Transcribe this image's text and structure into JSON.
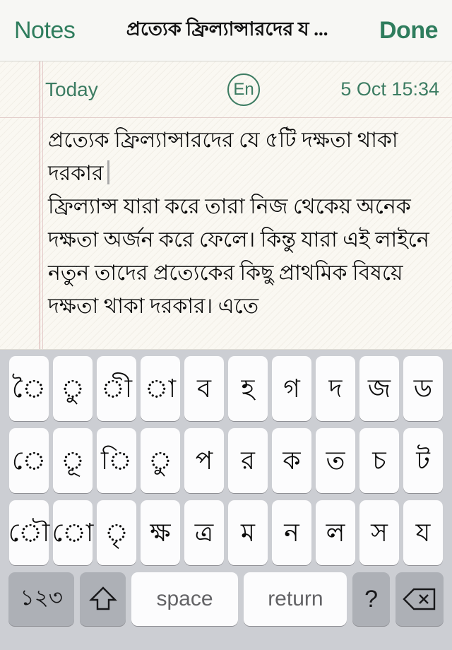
{
  "navbar": {
    "back_label": "Notes",
    "title": "প্রত্যেক ফ্রিল্যান্সারদের য ...",
    "done_label": "Done",
    "accent_color": "#2f7d5d"
  },
  "note": {
    "day_label": "Today",
    "language_badge": "En",
    "timestamp": "5 Oct 15:34",
    "body_text": "প্রত্যেক ফ্রিল্যান্সারদের যে ৫টি দক্ষতা থাকা দরকার",
    "body_rest": "\nফ্রিল্যান্স যারা করে তারা নিজ থেকেয় অনেক দক্ষতা অর্জন করে ফেলে। কিন্তু যারা এই লাইনে নতুন তাদের প্রত্যেকের কিছু প্রাথমিক বিষয়ে দক্ষতা থাকা দরকার। এতে",
    "paper_color": "#faf8f2",
    "margin_rule_color": "#c98f92",
    "meta_color": "#3c7c62"
  },
  "keyboard": {
    "background_color": "#ccced3",
    "key_color": "#fcfcfd",
    "fn_key_color": "#adb0b6",
    "rows": [
      {
        "name": "row-1",
        "keys": [
          {
            "label": "ৈ",
            "name": "key-vowel-oi"
          },
          {
            "label": "ু",
            "name": "key-vowel-u"
          },
          {
            "label": "ী",
            "name": "key-vowel-ii"
          },
          {
            "label": "া",
            "name": "key-vowel-aa"
          },
          {
            "label": "ব",
            "name": "key-ba"
          },
          {
            "label": "হ",
            "name": "key-ha"
          },
          {
            "label": "গ",
            "name": "key-ga"
          },
          {
            "label": "দ",
            "name": "key-da"
          },
          {
            "label": "জ",
            "name": "key-ja"
          },
          {
            "label": "ড",
            "name": "key-dda"
          }
        ]
      },
      {
        "name": "row-2",
        "keys": [
          {
            "label": "ে",
            "name": "key-vowel-e"
          },
          {
            "label": "ূ",
            "name": "key-vowel-uu"
          },
          {
            "label": "ি",
            "name": "key-vowel-i"
          },
          {
            "label": "ু",
            "name": "key-vowel-u-alt"
          },
          {
            "label": "প",
            "name": "key-pa"
          },
          {
            "label": "র",
            "name": "key-ra"
          },
          {
            "label": "ক",
            "name": "key-ka"
          },
          {
            "label": "ত",
            "name": "key-ta"
          },
          {
            "label": "চ",
            "name": "key-ca"
          },
          {
            "label": "ট",
            "name": "key-tta"
          }
        ]
      },
      {
        "name": "row-3",
        "keys": [
          {
            "label": "ৌ",
            "name": "key-vowel-ou"
          },
          {
            "label": "ো",
            "name": "key-vowel-o"
          },
          {
            "label": "ৃ",
            "name": "key-vowel-ri"
          },
          {
            "label": "ক্ষ",
            "name": "key-ksha"
          },
          {
            "label": "ত্র",
            "name": "key-tra"
          },
          {
            "label": "ম",
            "name": "key-ma"
          },
          {
            "label": "ন",
            "name": "key-na"
          },
          {
            "label": "ল",
            "name": "key-la"
          },
          {
            "label": "স",
            "name": "key-sa"
          },
          {
            "label": "য",
            "name": "key-ya"
          }
        ]
      }
    ],
    "function_row": {
      "numeric_label": "১২৩",
      "shift_icon": "shift-arrow-icon",
      "space_label": "space",
      "return_label": "return",
      "question_label": "?",
      "delete_icon": "backspace-icon"
    }
  }
}
